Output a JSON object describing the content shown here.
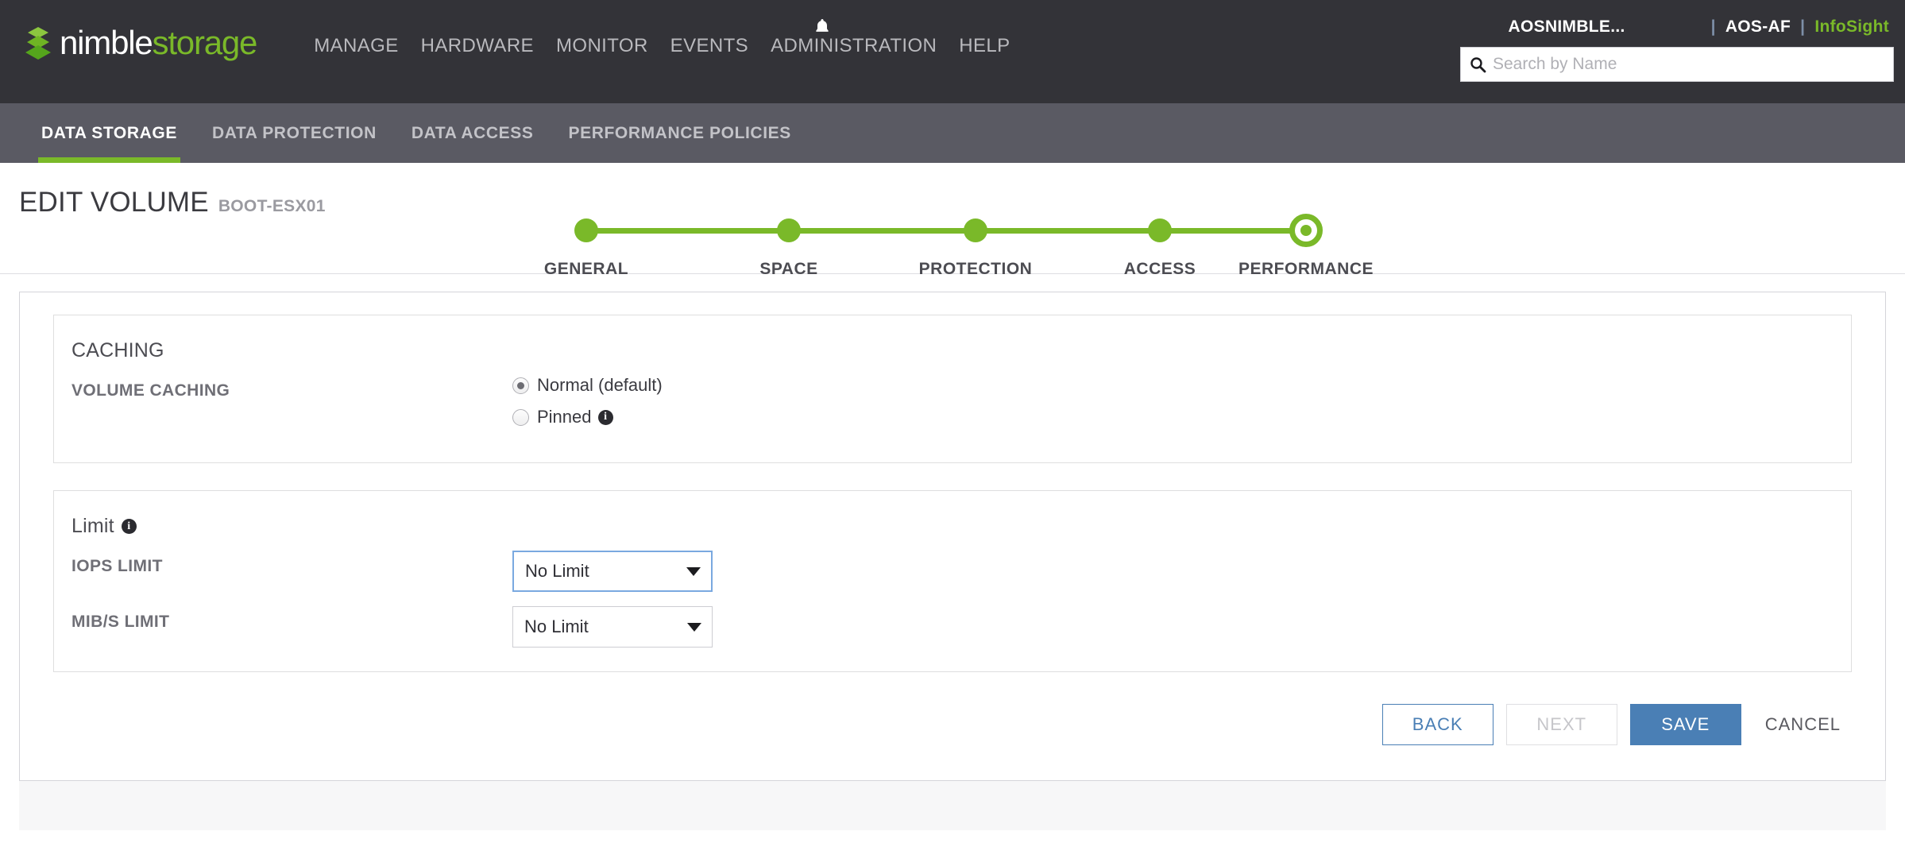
{
  "brand": {
    "part1": "nimble",
    "part2": "storage",
    "logo_icon": "stacked-layers-icon"
  },
  "topnav": {
    "items": [
      {
        "label": "MANAGE"
      },
      {
        "label": "HARDWARE"
      },
      {
        "label": "MONITOR"
      },
      {
        "label": "EVENTS"
      },
      {
        "label": "ADMINISTRATION"
      },
      {
        "label": "HELP"
      }
    ],
    "notification_icon": "bell-icon"
  },
  "account": {
    "user": "AOSNIMBLE...",
    "separator1": "|",
    "array": "AOS-AF",
    "separator2": "|",
    "infosight": "InfoSight",
    "infosight_color": "#7ab929"
  },
  "search": {
    "placeholder": "Search by Name",
    "value": "",
    "icon": "search-icon"
  },
  "tabs": [
    {
      "label": "DATA STORAGE",
      "active": true
    },
    {
      "label": "DATA PROTECTION",
      "active": false
    },
    {
      "label": "DATA ACCESS",
      "active": false
    },
    {
      "label": "PERFORMANCE POLICIES",
      "active": false
    }
  ],
  "page": {
    "title": "EDIT VOLUME",
    "subject": "BOOT-ESX01"
  },
  "wizard": {
    "accent_color": "#7ab929",
    "steps": [
      {
        "label": "GENERAL",
        "state": "complete"
      },
      {
        "label": "SPACE",
        "state": "complete"
      },
      {
        "label": "PROTECTION",
        "state": "complete"
      },
      {
        "label": "ACCESS",
        "state": "complete"
      },
      {
        "label": "PERFORMANCE",
        "state": "current"
      }
    ]
  },
  "caching": {
    "panel_title": "CACHING",
    "field_label": "VOLUME CACHING",
    "options": [
      {
        "label": "Normal (default)",
        "selected": true,
        "has_info": false
      },
      {
        "label": "Pinned",
        "selected": false,
        "has_info": true
      }
    ],
    "info_glyph": "i"
  },
  "limit": {
    "panel_title": "Limit",
    "info_glyph": "i",
    "rows": [
      {
        "label": "IOPS LIMIT",
        "value": "No Limit",
        "focused": true
      },
      {
        "label": "MIB/S LIMIT",
        "value": "No Limit",
        "focused": false
      }
    ]
  },
  "buttons": {
    "back": "BACK",
    "next": "NEXT",
    "save": "SAVE",
    "cancel": "CANCEL",
    "save_color": "#4a7fb5"
  }
}
